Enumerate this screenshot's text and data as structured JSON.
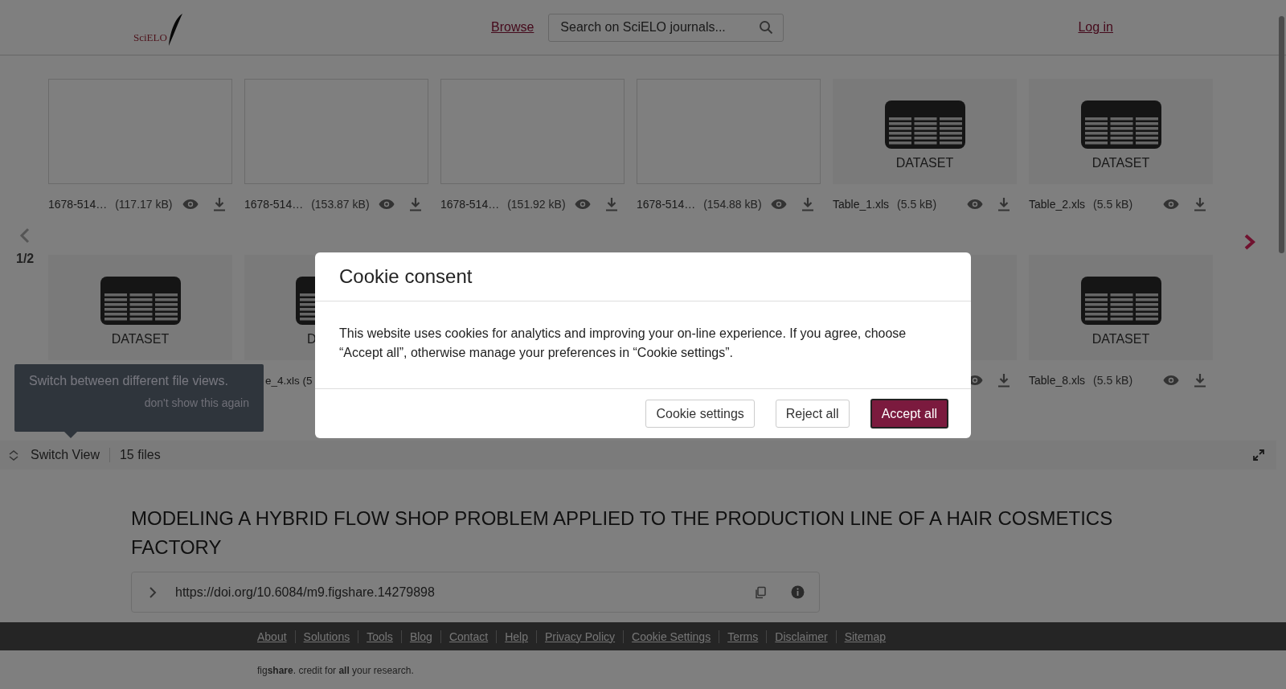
{
  "header": {
    "logo": "SciELO",
    "nav_link": "Browse",
    "search": {
      "placeholder": "Search on SciELO journals..."
    },
    "login_link": "Log in"
  },
  "files": {
    "page": "1/2",
    "rows": [
      [
        {
          "kind": "blank",
          "name": "1678-514…",
          "size": "(117.17 kB)"
        },
        {
          "kind": "blank",
          "name": "1678-514…",
          "size": "(153.87 kB)"
        },
        {
          "kind": "blank",
          "name": "1678-514…",
          "size": "(151.92 kB)"
        },
        {
          "kind": "blank",
          "name": "1678-514…",
          "size": "(154.88 kB)"
        },
        {
          "kind": "dataset",
          "caption": "DATASET",
          "name": "Table_1.xls",
          "size": "(5.5 kB)"
        },
        {
          "kind": "dataset",
          "caption": "DATASET",
          "name": "Table_2.xls",
          "size": "(5.5 kB)"
        }
      ],
      [
        {
          "kind": "dataset",
          "caption": "DATASET"
        },
        {
          "kind": "dataset_clipped",
          "caption": "D",
          "name": "e_4.xls (5"
        },
        "",
        "",
        {
          "kind": "actions_only"
        },
        {
          "kind": "dataset",
          "caption": "DATASET",
          "name": "Table_8.xls",
          "size": "(5.5 kB)"
        }
      ]
    ],
    "tooltip": {
      "text": "Switch between different file views.",
      "dismiss": "don't show this again"
    },
    "toolbar": {
      "switch_view": "Switch View",
      "count": "15 files"
    }
  },
  "article": {
    "title": "MODELING A HYBRID FLOW SHOP PROBLEM APPLIED TO THE PRODUCTION LINE OF A HAIR COSMETICS FACTORY",
    "doi": "https://doi.org/10.6084/m9.figshare.14279898"
  },
  "footer": {
    "links": [
      "About",
      "Solutions",
      "Tools",
      "Blog",
      "Contact",
      "Help",
      "Privacy Policy",
      "Cookie Settings",
      "Terms",
      "Disclaimer",
      "Sitemap"
    ],
    "tagline": "fig**share**. credit for **all** your research."
  },
  "cookie_modal": {
    "title": "Cookie consent",
    "text": "This website uses cookies for analytics and improving your on-line experience. If you agree, choose “Accept all”, otherwise manage your preferences in “Cookie settings”.",
    "buttons": [
      {
        "label": "Cookie settings",
        "kind": "secondary"
      },
      {
        "label": "Reject all",
        "kind": "secondary"
      },
      {
        "label": "Accept all",
        "kind": "primary"
      }
    ]
  }
}
